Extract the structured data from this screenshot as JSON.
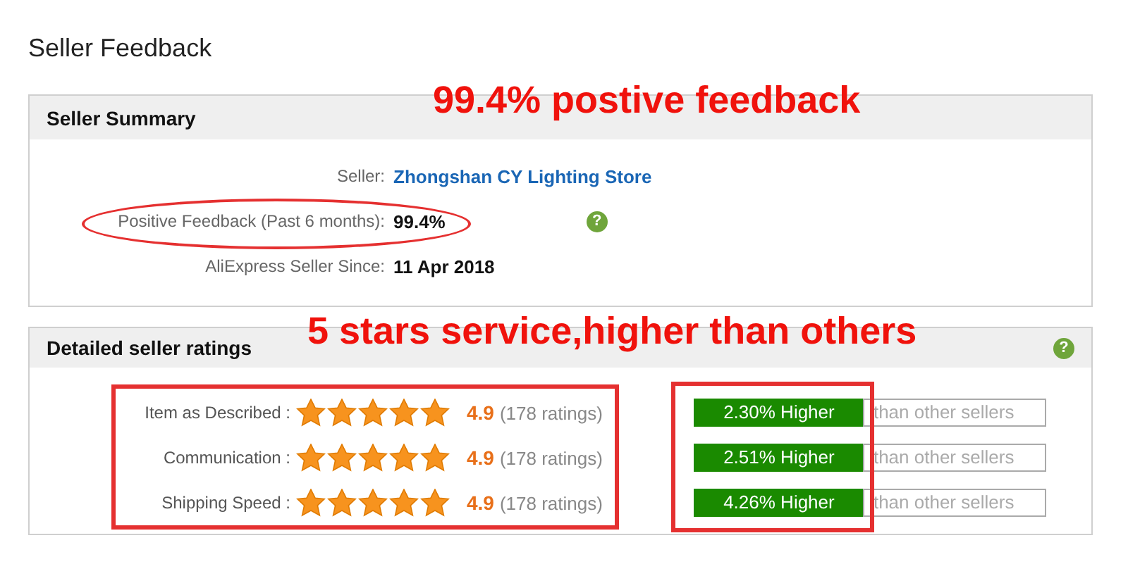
{
  "page_title": "Seller Feedback",
  "summary": {
    "title": "Seller Summary",
    "help": "?",
    "rows": [
      {
        "kind": "link",
        "label": "Seller:",
        "value": "Zhongshan CY Lighting Store"
      },
      {
        "kind": "text",
        "label": "Positive Feedback (Past 6 months):",
        "value": "99.4%"
      },
      {
        "kind": "text",
        "label": "AliExpress Seller Since:",
        "value": "11 Apr 2018"
      }
    ]
  },
  "ratings": {
    "title": "Detailed seller ratings",
    "help": "?",
    "rows": [
      {
        "label": "Item as Described :",
        "stars": 5,
        "score": "4.9",
        "count": "(178 ratings)",
        "compare": "2.30% Higher",
        "compare_note": "than other sellers"
      },
      {
        "label": "Communication :",
        "stars": 5,
        "score": "4.9",
        "count": "(178 ratings)",
        "compare": "2.51% Higher",
        "compare_note": "than other sellers"
      },
      {
        "label": "Shipping Speed :",
        "stars": 5,
        "score": "4.9",
        "count": "(178 ratings)",
        "compare": "4.26% Higher",
        "compare_note": "than other sellers"
      }
    ]
  },
  "annotations": [
    "99.4% postive feedback",
    "5 stars service,higher than others"
  ]
}
